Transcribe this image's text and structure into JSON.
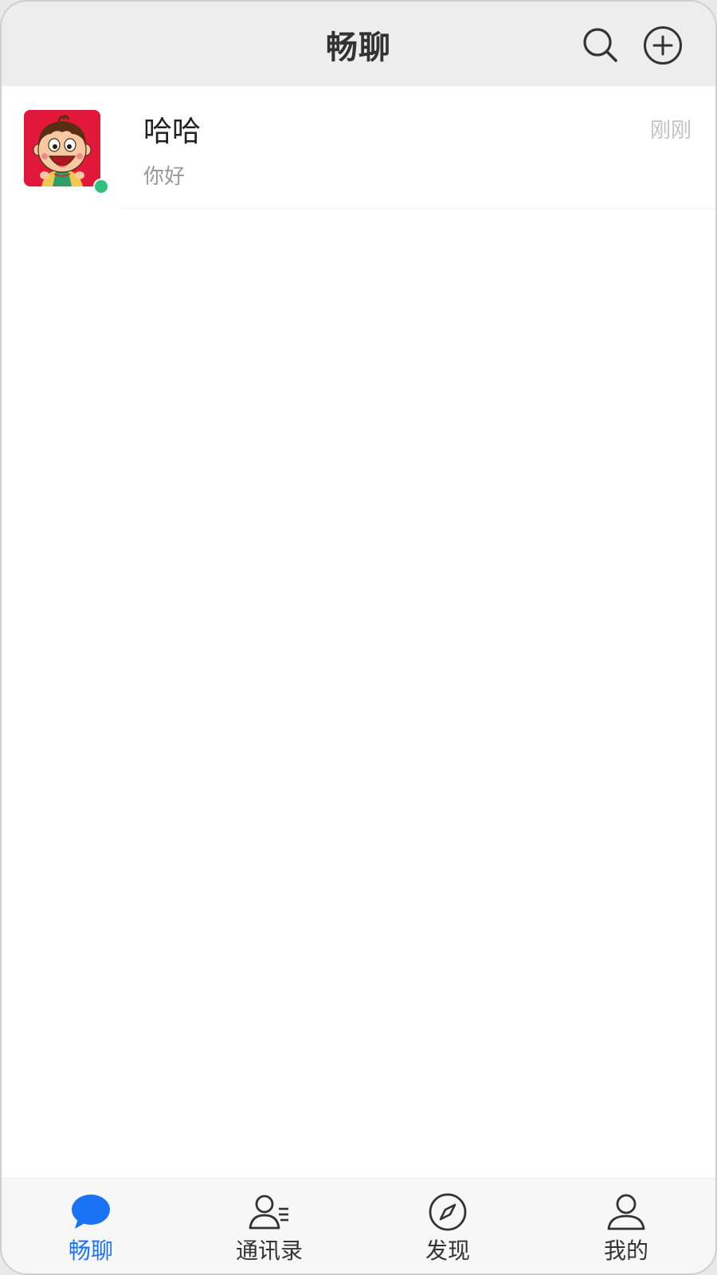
{
  "header": {
    "title": "畅聊",
    "search_icon": "search-icon",
    "add_icon": "plus-circle-icon"
  },
  "chats": [
    {
      "name": "哈哈",
      "preview": "你好",
      "time": "刚刚",
      "online": true,
      "avatar_icon": "cartoon-boy-avatar"
    }
  ],
  "tabs": [
    {
      "label": "畅聊",
      "icon": "chat-bubble-icon",
      "active": true
    },
    {
      "label": "通讯录",
      "icon": "contacts-icon",
      "active": false
    },
    {
      "label": "发现",
      "icon": "compass-icon",
      "active": false
    },
    {
      "label": "我的",
      "icon": "user-icon",
      "active": false
    }
  ],
  "colors": {
    "accent": "#1a73f5",
    "online": "#2ec27e",
    "header_bg": "#ededed",
    "tabbar_bg": "#f7f7f7",
    "avatar_bg": "#e2183a"
  }
}
